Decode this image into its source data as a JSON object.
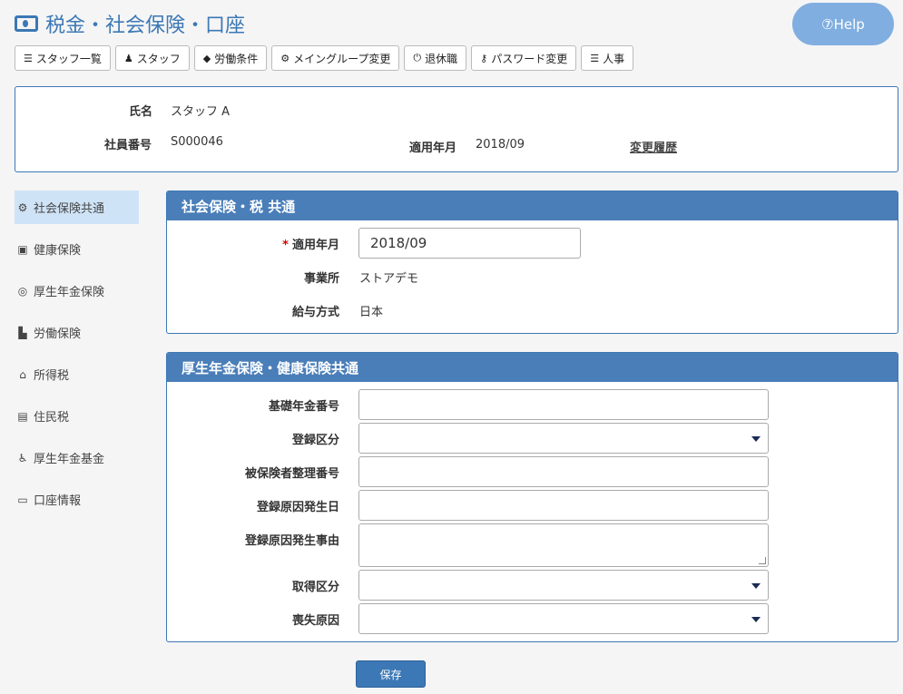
{
  "page": {
    "title": "税金・社会保険・口座",
    "title_icon": "money-icon"
  },
  "help": {
    "label": "⑦Help"
  },
  "toolbar": [
    {
      "icon": "list-icon",
      "glyph": "☰",
      "label": "スタッフ一覧"
    },
    {
      "icon": "user-icon",
      "glyph": "♟",
      "label": "スタッフ"
    },
    {
      "icon": "tag-icon",
      "glyph": "◆",
      "label": "労働条件"
    },
    {
      "icon": "gears-icon",
      "glyph": "⚙",
      "label": "メイングループ変更"
    },
    {
      "icon": "power-icon",
      "glyph": "⏻",
      "label": "退休職"
    },
    {
      "icon": "key-icon",
      "glyph": "⚷",
      "label": "パスワード変更"
    },
    {
      "icon": "list-icon",
      "glyph": "☰",
      "label": "人事"
    }
  ],
  "info": {
    "name_label": "氏名",
    "name_value": "スタッフ A",
    "id_label": "社員番号",
    "id_value": "S000046",
    "date_label": "適用年月",
    "date_value": "2018/09",
    "history_link": "変更履歴"
  },
  "sidenav": [
    {
      "icon": "gear-icon",
      "glyph": "⚙",
      "label": "社会保険共通",
      "active": true
    },
    {
      "icon": "medkit-icon",
      "glyph": "▣",
      "label": "健康保険"
    },
    {
      "icon": "lifebuoy-icon",
      "glyph": "◎",
      "label": "厚生年金保険"
    },
    {
      "icon": "industry-icon",
      "glyph": "▙",
      "label": "労働保険"
    },
    {
      "icon": "bank-icon",
      "glyph": "⌂",
      "label": "所得税"
    },
    {
      "icon": "building-icon",
      "glyph": "▤",
      "label": "住民税"
    },
    {
      "icon": "wheelchair-icon",
      "glyph": "♿",
      "label": "厚生年金基金"
    },
    {
      "icon": "credit-card-icon",
      "glyph": "▭",
      "label": "口座情報"
    }
  ],
  "panel1": {
    "title": "社会保険・税 共通",
    "date_label": "適用年月",
    "date_required_mark": "*",
    "date_value": "2018/09",
    "office_label": "事業所",
    "office_value": "ストアデモ",
    "salary_label": "給与方式",
    "salary_value": "日本"
  },
  "panel2": {
    "title": "厚生年金保険・健康保険共通",
    "fields": {
      "pension_no": {
        "label": "基礎年金番号",
        "value": ""
      },
      "reg_type": {
        "label": "登録区分",
        "value": ""
      },
      "insured_no": {
        "label": "被保険者整理番号",
        "value": ""
      },
      "reg_date": {
        "label": "登録原因発生日",
        "value": ""
      },
      "reg_reason": {
        "label": "登録原因発生事由",
        "value": ""
      },
      "acq_type": {
        "label": "取得区分",
        "value": ""
      },
      "loss_reason": {
        "label": "喪失原因",
        "value": ""
      }
    }
  },
  "save": {
    "label": "保存"
  }
}
